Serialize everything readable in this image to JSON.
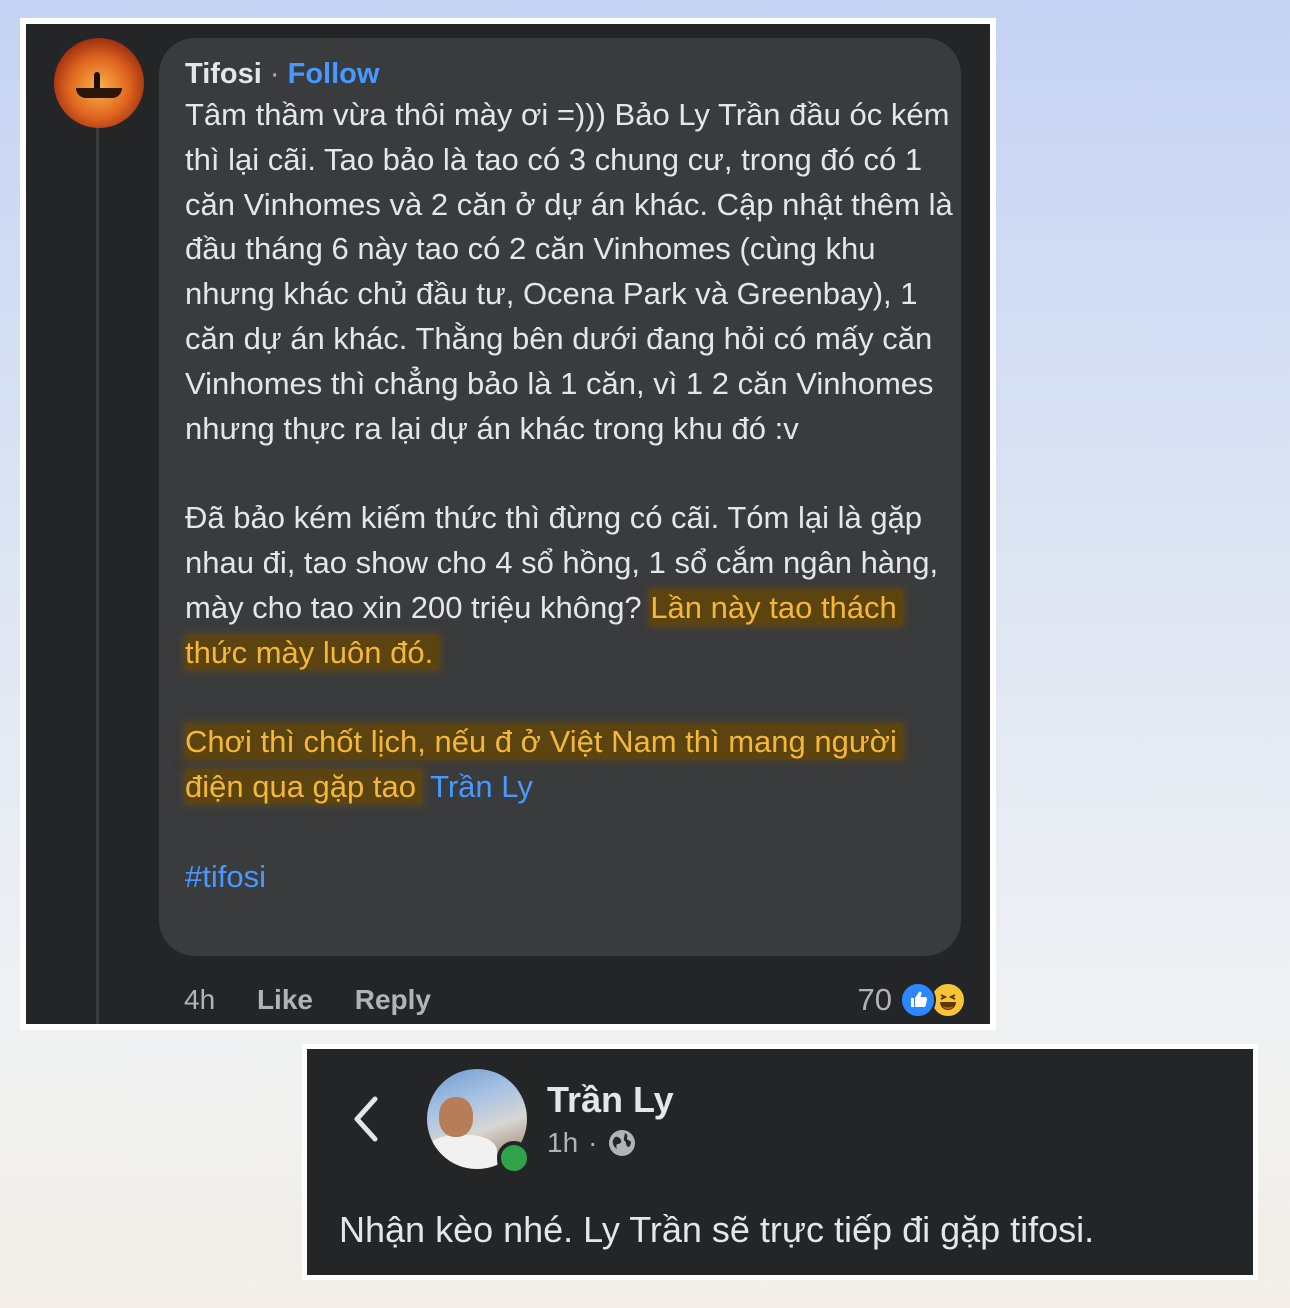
{
  "comment": {
    "author": "Tifosi",
    "separator": "·",
    "follow_label": "Follow",
    "paragraph_1": "Tâm thầm vừa thôi mày ơi =))) Bảo Ly Trần đầu óc kém thì lại cãi. Tao bảo là tao có 3 chung cư, trong đó có 1 căn Vinhomes và 2 căn ở dự án khác. Cập nhật thêm là đầu tháng 6 này tao có 2 căn Vinhomes (cùng khu nhưng khác chủ đầu tư, Ocena Park và Greenbay), 1 căn dự án khác. Thằng bên dưới đang hỏi có mấy căn Vinhomes thì chẳng bảo là 1 căn, vì 1 2 căn Vinhomes nhưng thực ra lại dự án khác trong khu đó :v",
    "paragraph_2": "Đã bảo kém kiếm thức thì đừng có cãi. Tóm lại là gặp nhau đi, tao show cho 4 sổ hồng, 1 sổ cắm ngân hàng, mày cho tao xin 200 triệu không?",
    "paragraph_2_highlight": "Lần này tao thách thức mày luôn đó.",
    "paragraph_3_highlight": "Chơi thì chốt lịch, nếu đ ở Việt Nam thì mang người điện qua gặp tao",
    "mention": "Trần Ly",
    "hashtag": "#tifosi",
    "time": "4h",
    "like_label": "Like",
    "reply_label": "Reply",
    "reaction_count": "70",
    "reaction_icons": [
      "like-icon",
      "haha-icon"
    ],
    "colors": {
      "highlight_text": "#f4b73a",
      "link": "#4599ff",
      "bubble": "#3a3b3c",
      "card": "#242526"
    }
  },
  "post": {
    "back_icon": "chevron-left-icon",
    "author": "Trần Ly",
    "time": "1h",
    "separator": "·",
    "privacy_icon": "globe-icon",
    "text": "Nhận kèo nhé. Ly Trần sẽ trực tiếp đi gặp tifosi."
  }
}
